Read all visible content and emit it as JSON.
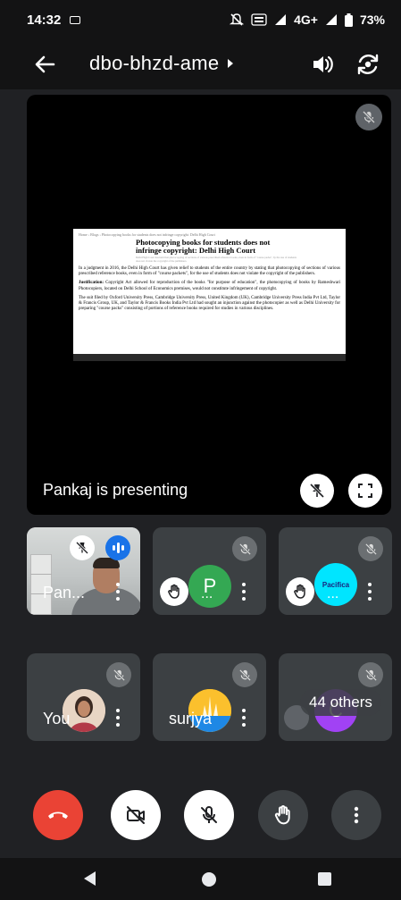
{
  "status": {
    "time": "14:32",
    "signal": "4G+",
    "battery": "73%"
  },
  "meeting": {
    "code": "dbo-bhzd-ame"
  },
  "stage": {
    "presenting_label": "Pankaj is presenting",
    "doc": {
      "topline": "Home › Blogs › Photocopying books for students does not infringe copyright: Delhi High Court",
      "title": "Photocopying books for students does not infringe copyright: Delhi High Court",
      "subtitle": "Delhi High Court has held that photocopying of sections of various prescribed reference books, even in form of \"course packs\", by the use of students does not violate the copyright of the publishers.",
      "para1": "In a judgment in 2016, the Delhi High Court has given relief to students of the entire country by stating that photocopying of sections of various prescribed reference books, even in form of \"course packets\", for the use of students does not violate the copyright of the publishers.",
      "para2_bold": "Justification:",
      "para2": " Copyright Act allowed for reproduction of the books \"for purpose of education\", the photocopying of books by Rameshwari Photocopiers, located on Delhi School of Economics premises, would not constitute infringement of copyright.",
      "para3": "The suit filed by Oxford University Press, Cambridge University Press, United Kingdom (UK), Cambridge University Press India Pvt Ltd, Taylor & Francis Group, UK, and Taylor & Francis Books India Pvt Ltd had sought an injunction against the photocopier as well as Delhi University for preparing \"course packs\" consisting of portions of reference books required for studies in various disciplines."
    }
  },
  "participants": [
    {
      "name": "Pan...",
      "type": "video"
    },
    {
      "initial": "P",
      "ellipsis": "...",
      "color": "#34a853"
    },
    {
      "ellipsis": "...",
      "avatar_text": "Pacifica",
      "color": "#00e5ff"
    },
    {
      "name": "You"
    },
    {
      "name": "surjya"
    },
    {
      "initial": "C",
      "color": "#a142f4",
      "others_label": "44 others"
    }
  ]
}
